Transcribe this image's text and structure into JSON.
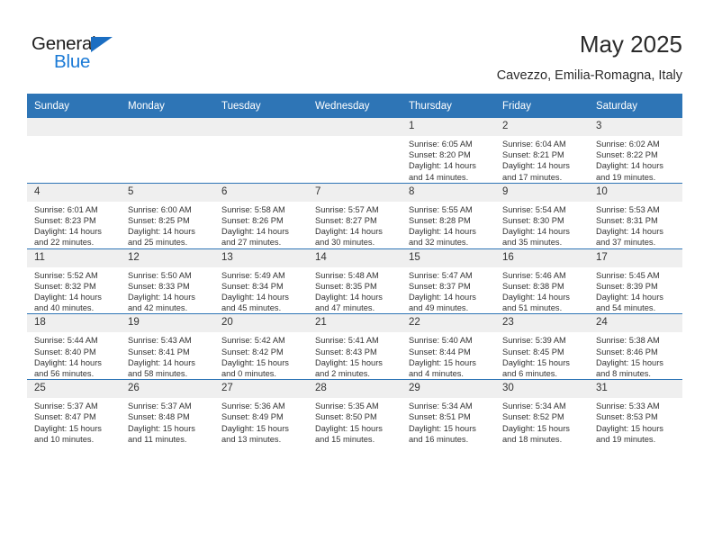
{
  "brand": {
    "name_top": "General",
    "name_bottom": "Blue",
    "accent_color": "#1b7ad6"
  },
  "header": {
    "title": "May 2025",
    "subtitle": "Cavezzo, Emilia-Romagna, Italy"
  },
  "theme": {
    "header_blue": "#2e75b6",
    "daynum_bg": "#efefef",
    "text": "#333333"
  },
  "weekdays": [
    "Sunday",
    "Monday",
    "Tuesday",
    "Wednesday",
    "Thursday",
    "Friday",
    "Saturday"
  ],
  "weeks": [
    [
      {
        "day": "",
        "lines": []
      },
      {
        "day": "",
        "lines": []
      },
      {
        "day": "",
        "lines": []
      },
      {
        "day": "",
        "lines": []
      },
      {
        "day": "1",
        "lines": [
          "Sunrise: 6:05 AM",
          "Sunset: 8:20 PM",
          "Daylight: 14 hours",
          "and 14 minutes."
        ]
      },
      {
        "day": "2",
        "lines": [
          "Sunrise: 6:04 AM",
          "Sunset: 8:21 PM",
          "Daylight: 14 hours",
          "and 17 minutes."
        ]
      },
      {
        "day": "3",
        "lines": [
          "Sunrise: 6:02 AM",
          "Sunset: 8:22 PM",
          "Daylight: 14 hours",
          "and 19 minutes."
        ]
      }
    ],
    [
      {
        "day": "4",
        "lines": [
          "Sunrise: 6:01 AM",
          "Sunset: 8:23 PM",
          "Daylight: 14 hours",
          "and 22 minutes."
        ]
      },
      {
        "day": "5",
        "lines": [
          "Sunrise: 6:00 AM",
          "Sunset: 8:25 PM",
          "Daylight: 14 hours",
          "and 25 minutes."
        ]
      },
      {
        "day": "6",
        "lines": [
          "Sunrise: 5:58 AM",
          "Sunset: 8:26 PM",
          "Daylight: 14 hours",
          "and 27 minutes."
        ]
      },
      {
        "day": "7",
        "lines": [
          "Sunrise: 5:57 AM",
          "Sunset: 8:27 PM",
          "Daylight: 14 hours",
          "and 30 minutes."
        ]
      },
      {
        "day": "8",
        "lines": [
          "Sunrise: 5:55 AM",
          "Sunset: 8:28 PM",
          "Daylight: 14 hours",
          "and 32 minutes."
        ]
      },
      {
        "day": "9",
        "lines": [
          "Sunrise: 5:54 AM",
          "Sunset: 8:30 PM",
          "Daylight: 14 hours",
          "and 35 minutes."
        ]
      },
      {
        "day": "10",
        "lines": [
          "Sunrise: 5:53 AM",
          "Sunset: 8:31 PM",
          "Daylight: 14 hours",
          "and 37 minutes."
        ]
      }
    ],
    [
      {
        "day": "11",
        "lines": [
          "Sunrise: 5:52 AM",
          "Sunset: 8:32 PM",
          "Daylight: 14 hours",
          "and 40 minutes."
        ]
      },
      {
        "day": "12",
        "lines": [
          "Sunrise: 5:50 AM",
          "Sunset: 8:33 PM",
          "Daylight: 14 hours",
          "and 42 minutes."
        ]
      },
      {
        "day": "13",
        "lines": [
          "Sunrise: 5:49 AM",
          "Sunset: 8:34 PM",
          "Daylight: 14 hours",
          "and 45 minutes."
        ]
      },
      {
        "day": "14",
        "lines": [
          "Sunrise: 5:48 AM",
          "Sunset: 8:35 PM",
          "Daylight: 14 hours",
          "and 47 minutes."
        ]
      },
      {
        "day": "15",
        "lines": [
          "Sunrise: 5:47 AM",
          "Sunset: 8:37 PM",
          "Daylight: 14 hours",
          "and 49 minutes."
        ]
      },
      {
        "day": "16",
        "lines": [
          "Sunrise: 5:46 AM",
          "Sunset: 8:38 PM",
          "Daylight: 14 hours",
          "and 51 minutes."
        ]
      },
      {
        "day": "17",
        "lines": [
          "Sunrise: 5:45 AM",
          "Sunset: 8:39 PM",
          "Daylight: 14 hours",
          "and 54 minutes."
        ]
      }
    ],
    [
      {
        "day": "18",
        "lines": [
          "Sunrise: 5:44 AM",
          "Sunset: 8:40 PM",
          "Daylight: 14 hours",
          "and 56 minutes."
        ]
      },
      {
        "day": "19",
        "lines": [
          "Sunrise: 5:43 AM",
          "Sunset: 8:41 PM",
          "Daylight: 14 hours",
          "and 58 minutes."
        ]
      },
      {
        "day": "20",
        "lines": [
          "Sunrise: 5:42 AM",
          "Sunset: 8:42 PM",
          "Daylight: 15 hours",
          "and 0 minutes."
        ]
      },
      {
        "day": "21",
        "lines": [
          "Sunrise: 5:41 AM",
          "Sunset: 8:43 PM",
          "Daylight: 15 hours",
          "and 2 minutes."
        ]
      },
      {
        "day": "22",
        "lines": [
          "Sunrise: 5:40 AM",
          "Sunset: 8:44 PM",
          "Daylight: 15 hours",
          "and 4 minutes."
        ]
      },
      {
        "day": "23",
        "lines": [
          "Sunrise: 5:39 AM",
          "Sunset: 8:45 PM",
          "Daylight: 15 hours",
          "and 6 minutes."
        ]
      },
      {
        "day": "24",
        "lines": [
          "Sunrise: 5:38 AM",
          "Sunset: 8:46 PM",
          "Daylight: 15 hours",
          "and 8 minutes."
        ]
      }
    ],
    [
      {
        "day": "25",
        "lines": [
          "Sunrise: 5:37 AM",
          "Sunset: 8:47 PM",
          "Daylight: 15 hours",
          "and 10 minutes."
        ]
      },
      {
        "day": "26",
        "lines": [
          "Sunrise: 5:37 AM",
          "Sunset: 8:48 PM",
          "Daylight: 15 hours",
          "and 11 minutes."
        ]
      },
      {
        "day": "27",
        "lines": [
          "Sunrise: 5:36 AM",
          "Sunset: 8:49 PM",
          "Daylight: 15 hours",
          "and 13 minutes."
        ]
      },
      {
        "day": "28",
        "lines": [
          "Sunrise: 5:35 AM",
          "Sunset: 8:50 PM",
          "Daylight: 15 hours",
          "and 15 minutes."
        ]
      },
      {
        "day": "29",
        "lines": [
          "Sunrise: 5:34 AM",
          "Sunset: 8:51 PM",
          "Daylight: 15 hours",
          "and 16 minutes."
        ]
      },
      {
        "day": "30",
        "lines": [
          "Sunrise: 5:34 AM",
          "Sunset: 8:52 PM",
          "Daylight: 15 hours",
          "and 18 minutes."
        ]
      },
      {
        "day": "31",
        "lines": [
          "Sunrise: 5:33 AM",
          "Sunset: 8:53 PM",
          "Daylight: 15 hours",
          "and 19 minutes."
        ]
      }
    ]
  ]
}
